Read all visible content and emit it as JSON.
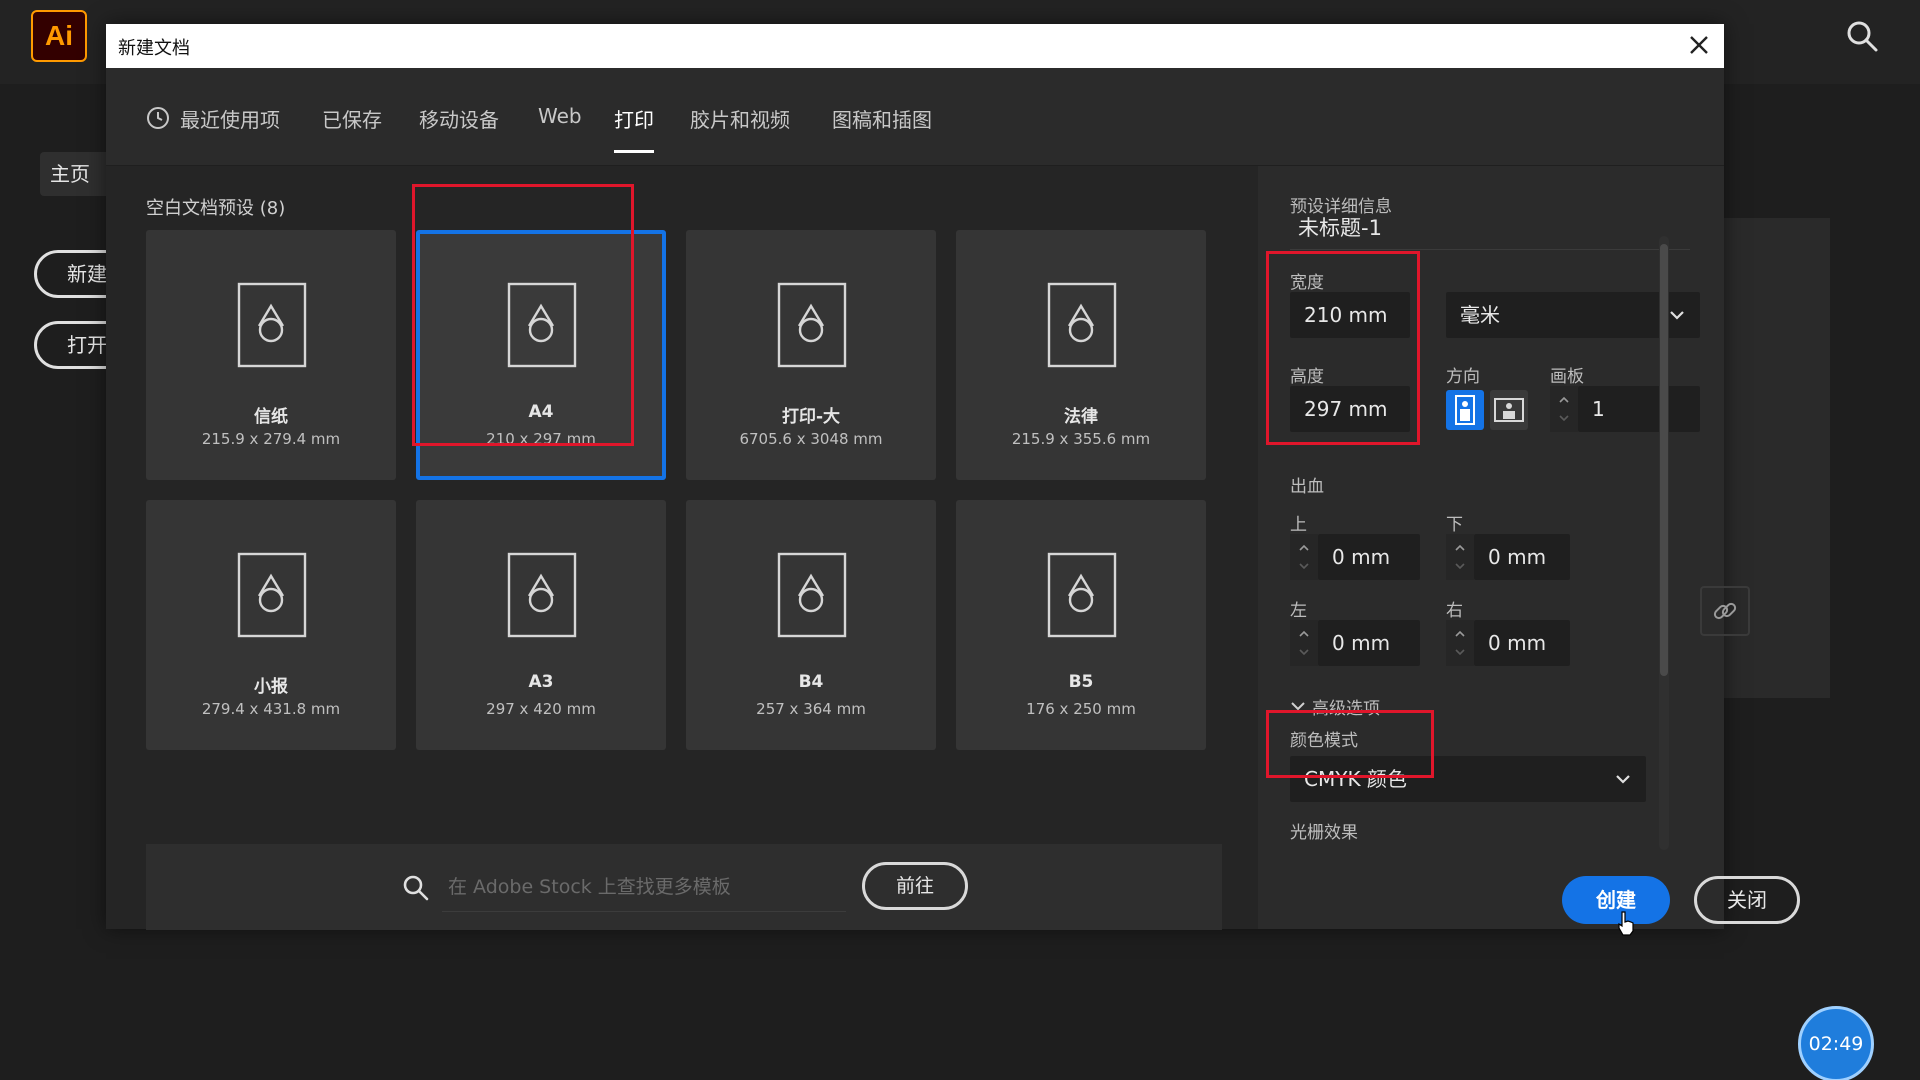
{
  "app": {
    "logo_text": "Ai",
    "brand_color": "#ff9a00",
    "accent_color": "#1473e6",
    "highlight_color": "#e0162b"
  },
  "home": {
    "nav_label": "主页",
    "new_button": "新建",
    "open_button": "打开"
  },
  "dialog": {
    "title": "新建文档",
    "tabs": [
      {
        "label": "最近使用项",
        "icon": "clock-icon"
      },
      {
        "label": "已保存"
      },
      {
        "label": "移动设备"
      },
      {
        "label": "Web"
      },
      {
        "label": "打印",
        "active": true
      },
      {
        "label": "胶片和视频"
      },
      {
        "label": "图稿和插图"
      }
    ],
    "presets_label": "空白文档预设 (8)",
    "presets": [
      {
        "name": "信纸",
        "dims": "215.9 x 279.4 mm"
      },
      {
        "name": "A4",
        "dims": "210 x 297 mm",
        "selected": true
      },
      {
        "name": "打印-大",
        "dims": "6705.6 x 3048 mm"
      },
      {
        "name": "法律",
        "dims": "215.9 x 355.6 mm"
      },
      {
        "name": "小报",
        "dims": "279.4 x 431.8 mm"
      },
      {
        "name": "A3",
        "dims": "297 x 420 mm"
      },
      {
        "name": "B4",
        "dims": "257 x 364 mm"
      },
      {
        "name": "B5",
        "dims": "176 x 250 mm"
      }
    ],
    "stock": {
      "placeholder": "在 Adobe Stock 上查找更多模板",
      "go_button": "前往"
    },
    "details": {
      "header": "预设详细信息",
      "doc_name": "未标题-1",
      "width_label": "宽度",
      "width_value": "210 mm",
      "units_value": "毫米",
      "height_label": "高度",
      "height_value": "297 mm",
      "orientation_label": "方向",
      "artboards_label": "画板",
      "artboards_value": "1",
      "bleed_label": "出血",
      "bleed_top_label": "上",
      "bleed_top_value": "0 mm",
      "bleed_bottom_label": "下",
      "bleed_bottom_value": "0 mm",
      "bleed_left_label": "左",
      "bleed_left_value": "0 mm",
      "bleed_right_label": "右",
      "bleed_right_value": "0 mm",
      "advanced_label": "高级选项",
      "color_mode_label": "颜色模式",
      "color_mode_value": "CMYK 颜色",
      "raster_label": "光栅效果"
    },
    "create_button": "创建",
    "close_button": "关闭"
  },
  "timer": "02:49"
}
